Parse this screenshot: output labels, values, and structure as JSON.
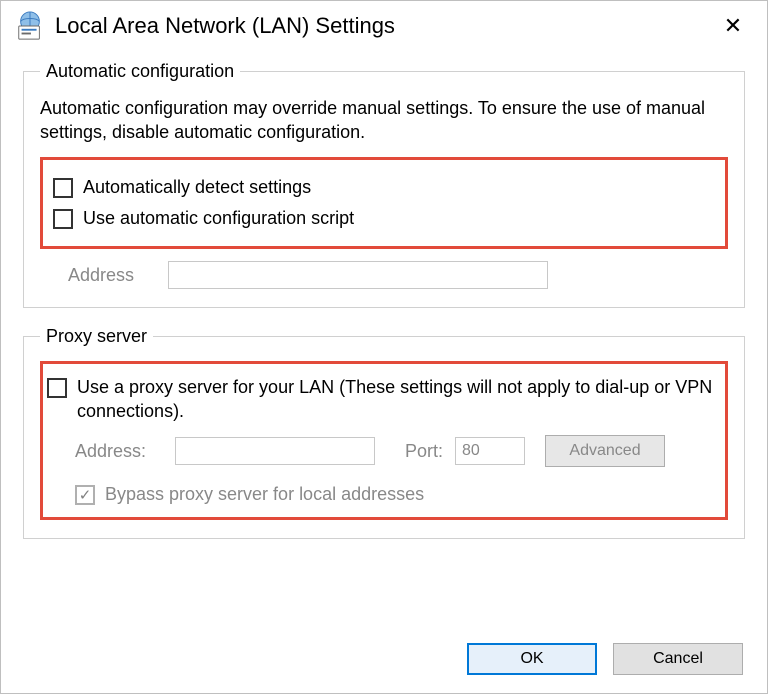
{
  "title": "Local Area Network (LAN) Settings",
  "close_glyph": "✕",
  "auto": {
    "legend": "Automatic configuration",
    "desc": "Automatic configuration may override manual settings.  To ensure the use of manual settings, disable automatic configuration.",
    "detect_label": "Automatically detect settings",
    "script_label": "Use automatic configuration script",
    "address_label": "Address",
    "address_value": ""
  },
  "proxy": {
    "legend": "Proxy server",
    "use_label": "Use a proxy server for your LAN (These settings will not apply to dial-up or VPN connections).",
    "address_label": "Address:",
    "address_value": "",
    "port_label": "Port:",
    "port_value": "80",
    "advanced_label": "Advanced",
    "bypass_label": "Bypass proxy server for local addresses"
  },
  "buttons": {
    "ok": "OK",
    "cancel": "Cancel"
  }
}
